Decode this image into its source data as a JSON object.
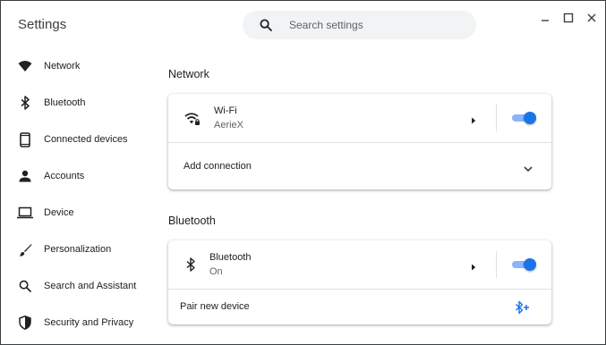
{
  "app": {
    "title": "Settings"
  },
  "search": {
    "placeholder": "Search settings"
  },
  "sidebar": {
    "items": [
      {
        "label": "Network",
        "icon": "wifi-icon"
      },
      {
        "label": "Bluetooth",
        "icon": "bluetooth-icon"
      },
      {
        "label": "Connected devices",
        "icon": "phone-icon"
      },
      {
        "label": "Accounts",
        "icon": "person-icon"
      },
      {
        "label": "Device",
        "icon": "laptop-icon"
      },
      {
        "label": "Personalization",
        "icon": "brush-icon"
      },
      {
        "label": "Search and Assistant",
        "icon": "search-icon"
      },
      {
        "label": "Security and Privacy",
        "icon": "shield-icon"
      }
    ]
  },
  "network": {
    "title": "Network",
    "wifi": {
      "name": "Wi-Fi",
      "ssid": "AerieX",
      "enabled": true
    },
    "add_connection": "Add connection"
  },
  "bluetooth": {
    "title": "Bluetooth",
    "name": "Bluetooth",
    "status": "On",
    "enabled": true,
    "pair_new": "Pair new device"
  },
  "colors": {
    "accent": "#1a73e8",
    "accent_light": "#8ab4f8",
    "search_bg": "#f1f3f4"
  }
}
